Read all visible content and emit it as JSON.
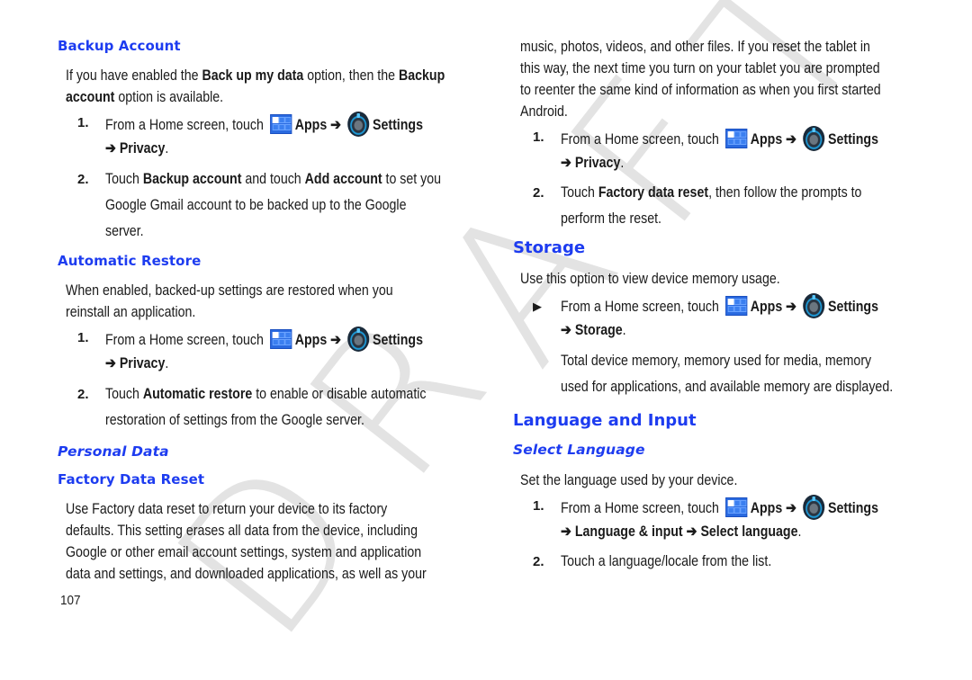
{
  "watermark": {
    "letters": [
      "D",
      "R",
      "A",
      "F",
      "T"
    ]
  },
  "page_number": "107",
  "left": {
    "backup": {
      "heading": "Backup Account",
      "intro": {
        "t1": "If you have enabled the ",
        "b1": "Back up my data",
        "t2": " option, then the ",
        "b2": "Backup",
        "b3": "account",
        "t3": " option is available."
      },
      "step1": {
        "num": "1.",
        "text": "From a Home screen, touch ",
        "apps": "Apps",
        "arrow": " ➔ ",
        "settings": "Settings",
        "path_arrow": "➔ ",
        "path": "Privacy",
        "end": "."
      },
      "step2": {
        "num": "2.",
        "t1": "Touch ",
        "b1": "Backup account",
        "t2": " and touch ",
        "b2": "Add account",
        "t3": " to set you",
        "line2": "Google Gmail account to be backed up to the Google",
        "line3": "server."
      }
    },
    "restore": {
      "heading": "Automatic Restore",
      "intro_l1": "When enabled, backed-up settings are restored when you",
      "intro_l2": "reinstall an application.",
      "step1": {
        "num": "1.",
        "text": "From a Home screen, touch ",
        "apps": "Apps",
        "arrow": " ➔ ",
        "settings": "Settings",
        "path_arrow": "➔ ",
        "path": "Privacy",
        "end": "."
      },
      "step2": {
        "num": "2.",
        "t1": "Touch ",
        "b1": "Automatic restore",
        "t2": " to enable or disable automatic",
        "line2": "restoration of settings from the Google server."
      }
    },
    "personal_heading": "Personal Data",
    "factory": {
      "heading": "Factory Data Reset",
      "lines": [
        "Use Factory data reset to return your device to its factory",
        "defaults. This setting erases all data from the device, including",
        "Google or other email account settings, system and application",
        "data and settings, and downloaded applications, as well as your"
      ]
    }
  },
  "right": {
    "factory_cont": {
      "lines": [
        "music, photos, videos, and other files. If you reset the tablet in",
        "this way, the next time you turn on your tablet you are prompted",
        "to reenter the same kind of information as when you first started",
        "Android."
      ],
      "step1": {
        "num": "1.",
        "text": "From a Home screen, touch ",
        "apps": "Apps",
        "arrow": " ➔ ",
        "settings": "Settings",
        "path_arrow": "➔ ",
        "path": "Privacy",
        "end": "."
      },
      "step2": {
        "num": "2.",
        "t1": "Touch ",
        "b1": "Factory data reset",
        "t2": ", then follow the prompts to",
        "line2": "perform the reset."
      }
    },
    "storage": {
      "heading": "Storage",
      "intro": "Use this option to view device memory usage.",
      "bullet": "▶",
      "step": {
        "text": "From a Home screen, touch ",
        "apps": "Apps",
        "arrow": " ➔ ",
        "settings": "Settings",
        "path_arrow": "➔ ",
        "path": "Storage",
        "end": "."
      },
      "note_l1": "Total device memory, memory used for media, memory",
      "note_l2": "used for applications, and available memory are displayed."
    },
    "language": {
      "heading": "Language and Input",
      "subheading": "Select Language",
      "intro": "Set the language used by your device.",
      "step1": {
        "num": "1.",
        "text": "From a Home screen, touch ",
        "apps": "Apps",
        "arrow": " ➔ ",
        "settings": "Settings",
        "path_arrow": "➔ ",
        "path1": "Language & input",
        "path_sep": " ➔ ",
        "path2": "Select language",
        "end": "."
      },
      "step2": {
        "num": "2.",
        "text": "Touch a language/locale from the list."
      }
    }
  }
}
